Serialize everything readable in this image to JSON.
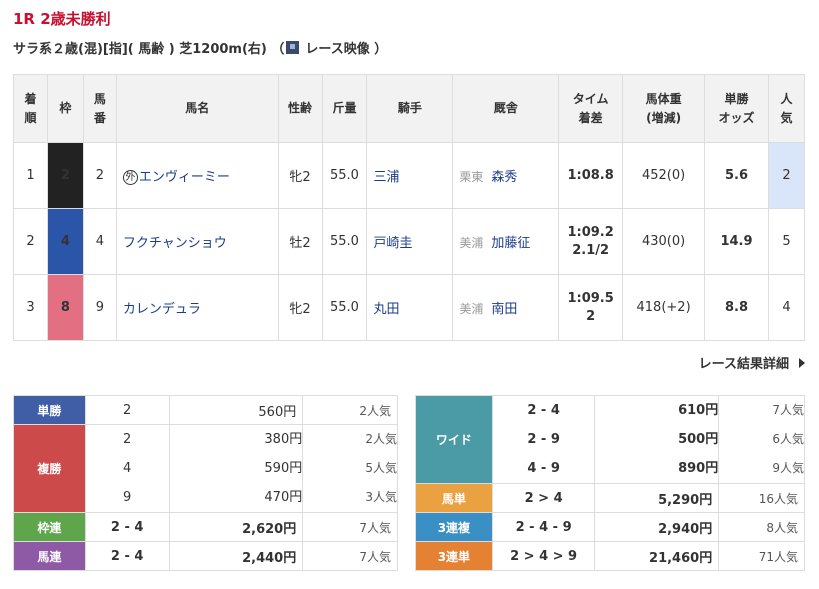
{
  "race": {
    "title": "1R 2歳未勝利",
    "info_before": "サラ系２歳(混)[指]( 馬齢 ) 芝1200m(右) （",
    "info_after": "レース映像 ）"
  },
  "results_headers": {
    "rank": [
      "着",
      "順"
    ],
    "waku": "枠",
    "umaban": [
      "馬",
      "番"
    ],
    "name": "馬名",
    "sexage": "性齢",
    "weight": "斤量",
    "jockey": "騎手",
    "trainer": "厩舎",
    "time": [
      "タイム",
      "着差"
    ],
    "body": [
      "馬体重",
      "(増減)"
    ],
    "odds": [
      "単勝",
      "オッズ"
    ],
    "pop": [
      "人",
      "気"
    ]
  },
  "results": [
    {
      "rank": "1",
      "waku": "2",
      "umaban": "2",
      "foreign_mark": "外",
      "name": "エンヴィーミー",
      "sexage": "牝2",
      "weight": "55.0",
      "jockey": "三浦",
      "aff": "栗東",
      "trainer": "森秀",
      "time": "1:08.8",
      "margin": "",
      "body": "452(0)",
      "odds": "5.6",
      "pop": "2"
    },
    {
      "rank": "2",
      "waku": "4",
      "umaban": "4",
      "foreign_mark": "",
      "name": "フクチャンショウ",
      "sexage": "牡2",
      "weight": "55.0",
      "jockey": "戸崎圭",
      "aff": "美浦",
      "trainer": "加藤征",
      "time": "1:09.2",
      "margin": "2.1/2",
      "body": "430(0)",
      "odds": "14.9",
      "pop": "5"
    },
    {
      "rank": "3",
      "waku": "8",
      "umaban": "9",
      "foreign_mark": "",
      "name": "カレンデュラ",
      "sexage": "牝2",
      "weight": "55.0",
      "jockey": "丸田",
      "aff": "美浦",
      "trainer": "南田",
      "time": "1:09.5",
      "margin": "2",
      "body": "418(+2)",
      "odds": "8.8",
      "pop": "4"
    }
  ],
  "detail_link": "レース結果詳細",
  "payouts_left": {
    "tansho": {
      "label": "単勝",
      "rows": [
        {
          "num": "2",
          "yen": "560円",
          "pop": "2人気"
        }
      ]
    },
    "fukusho": {
      "label": "複勝",
      "rows": [
        {
          "num": "2",
          "yen": "380円",
          "pop": "2人気"
        },
        {
          "num": "4",
          "yen": "590円",
          "pop": "5人気"
        },
        {
          "num": "9",
          "yen": "470円",
          "pop": "3人気"
        }
      ]
    },
    "wakuren": {
      "label": "枠連",
      "rows": [
        {
          "num": "2 - 4",
          "yen": "2,620円",
          "pop": "7人気"
        }
      ]
    },
    "umaren": {
      "label": "馬連",
      "rows": [
        {
          "num": "2 - 4",
          "yen": "2,440円",
          "pop": "7人気"
        }
      ]
    }
  },
  "payouts_right": {
    "wide": {
      "label": "ワイド",
      "rows": [
        {
          "num": "2 - 4",
          "yen": "610円",
          "pop": "7人気"
        },
        {
          "num": "2 - 9",
          "yen": "500円",
          "pop": "6人気"
        },
        {
          "num": "4 - 9",
          "yen": "890円",
          "pop": "9人気"
        }
      ]
    },
    "umatan": {
      "label": "馬単",
      "rows": [
        {
          "num": "2 > 4",
          "yen": "5,290円",
          "pop": "16人気"
        }
      ]
    },
    "sanrenpuku": {
      "label": "3連複",
      "rows": [
        {
          "num": "2 - 4 - 9",
          "yen": "2,940円",
          "pop": "8人気"
        }
      ]
    },
    "sanrentan": {
      "label": "3連単",
      "rows": [
        {
          "num": "2 > 4 > 9",
          "yen": "21,460円",
          "pop": "71人気"
        }
      ]
    }
  },
  "colors": {
    "title_red": "#c8102e",
    "link_blue": "#1a3c8a",
    "waku2": "#222222",
    "waku4": "#2b55a8",
    "waku8": "#e36f83",
    "tansho": "#3f5ea5",
    "fukusho": "#cc4a4a",
    "wakuren": "#5ea54b",
    "umaren": "#8f5aa5",
    "wide": "#4b9ba6",
    "umatan": "#e9a142",
    "sanrenpuku": "#3a8fc4",
    "sanrentan": "#e58132"
  }
}
